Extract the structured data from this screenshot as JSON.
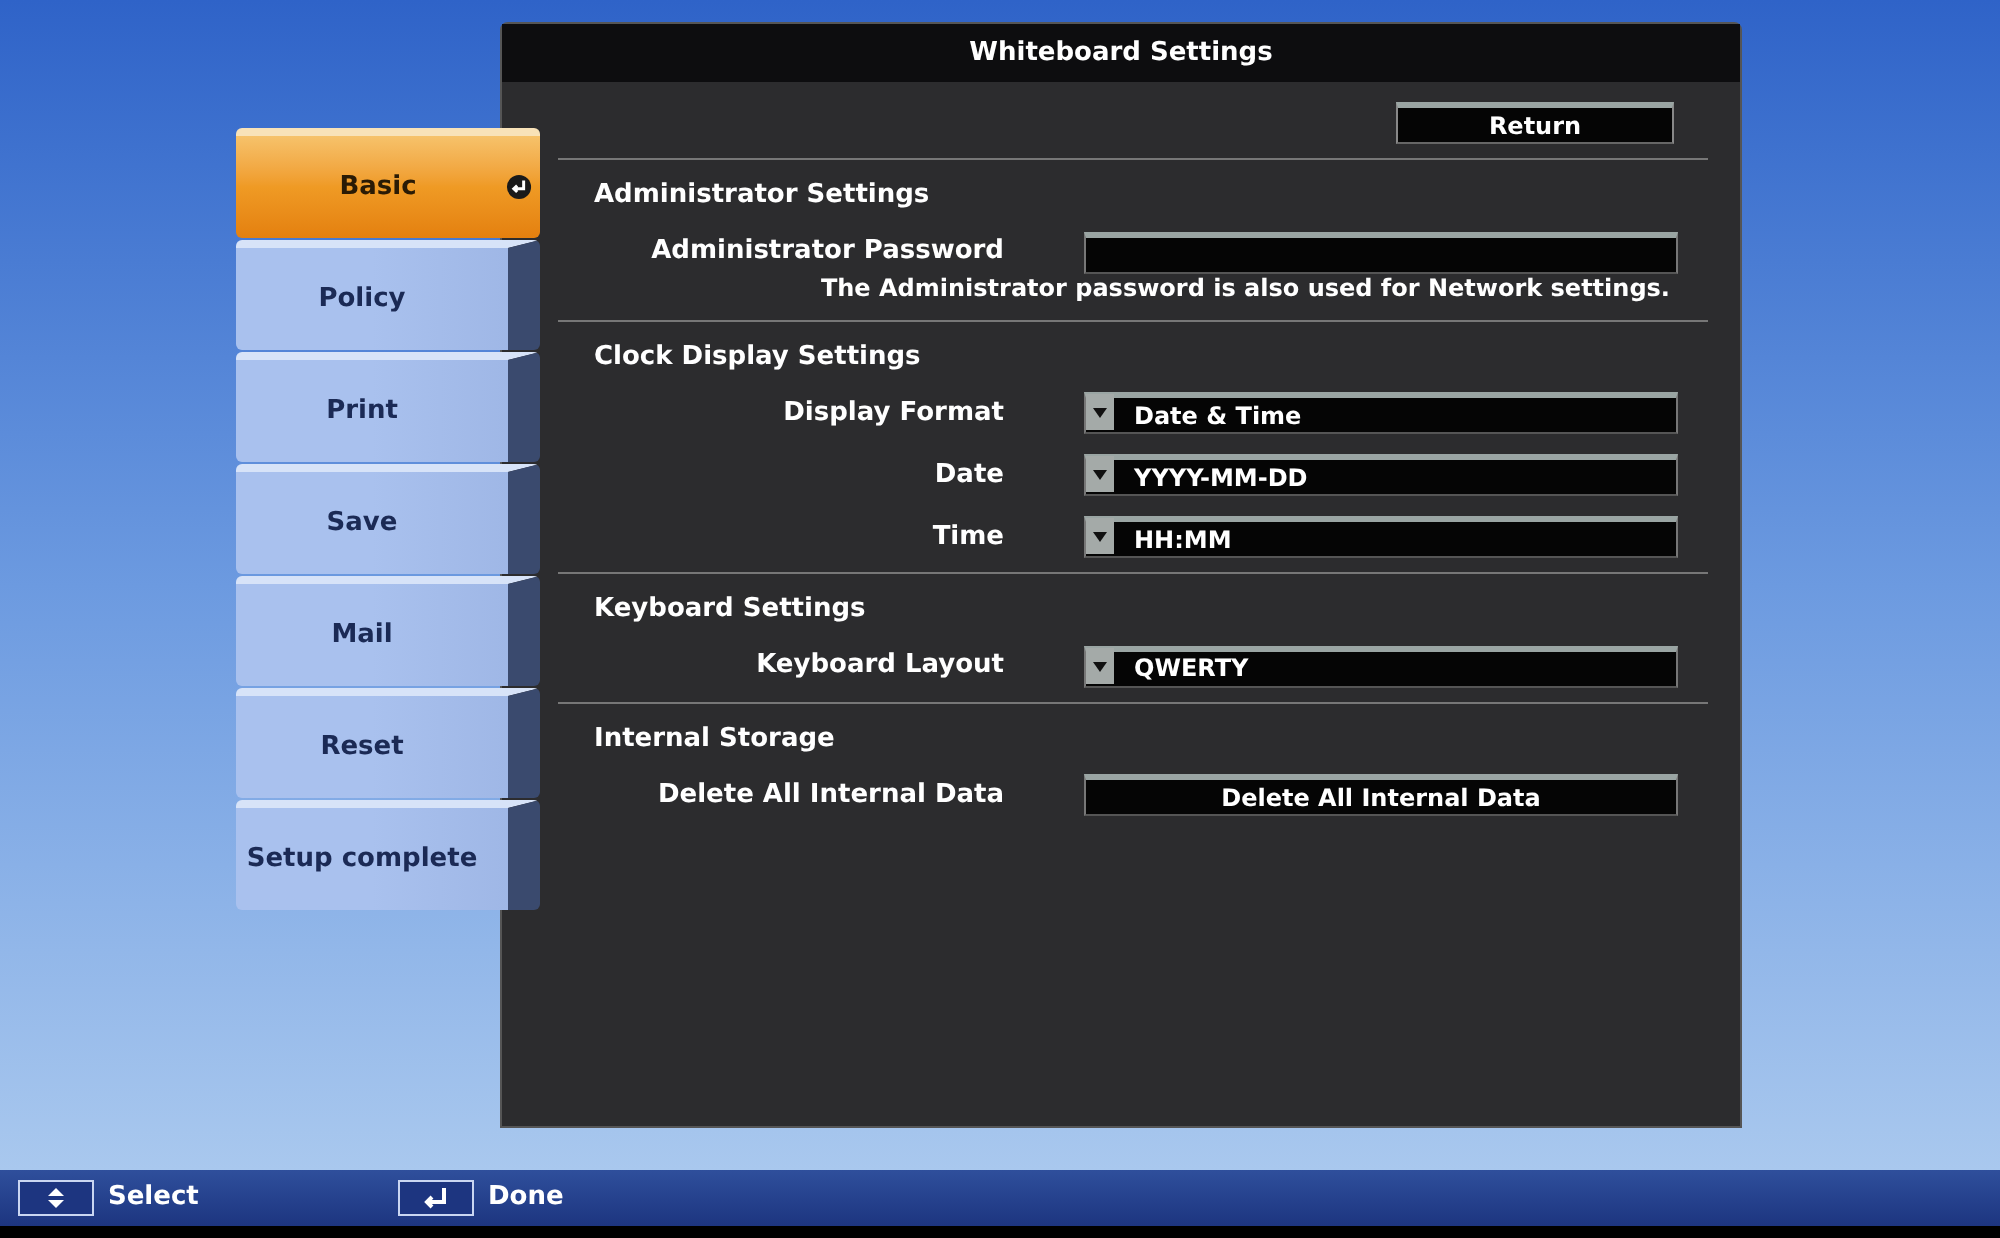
{
  "window": {
    "title": "Whiteboard Settings"
  },
  "return_button": {
    "label": "Return"
  },
  "sidebar": {
    "items": [
      {
        "label": "Basic",
        "selected": true
      },
      {
        "label": "Policy",
        "selected": false
      },
      {
        "label": "Print",
        "selected": false
      },
      {
        "label": "Save",
        "selected": false
      },
      {
        "label": "Mail",
        "selected": false
      },
      {
        "label": "Reset",
        "selected": false
      },
      {
        "label": "Setup complete",
        "selected": false
      }
    ]
  },
  "sections": [
    {
      "title": "Administrator Settings",
      "rows": [
        {
          "kind": "password",
          "label": "Administrator Password",
          "note": "The Administrator password is also used for Network settings."
        }
      ]
    },
    {
      "title": "Clock Display Settings",
      "rows": [
        {
          "kind": "dropdown",
          "label": "Display Format",
          "value": "Date & Time"
        },
        {
          "kind": "dropdown",
          "label": "Date",
          "value": "YYYY-MM-DD"
        },
        {
          "kind": "dropdown",
          "label": "Time",
          "value": "HH:MM"
        }
      ]
    },
    {
      "title": "Keyboard Settings",
      "rows": [
        {
          "kind": "dropdown",
          "label": "Keyboard Layout",
          "value": "QWERTY"
        }
      ]
    },
    {
      "title": "Internal Storage",
      "rows": [
        {
          "kind": "button",
          "label": "Delete All Internal Data",
          "value": "Delete All Internal Data"
        }
      ]
    }
  ],
  "footer": [
    {
      "kind": "updown",
      "label": "Select"
    },
    {
      "kind": "enter",
      "label": "Done"
    }
  ]
}
